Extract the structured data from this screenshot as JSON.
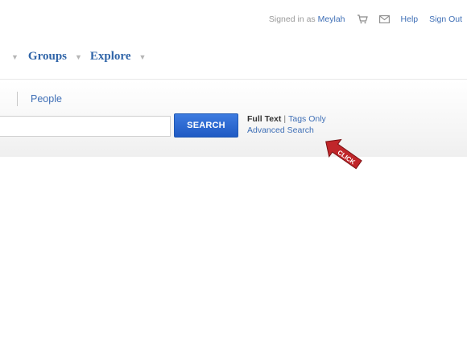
{
  "topbar": {
    "signed_in_as": "Signed in as",
    "username": "Meylah",
    "cart_icon": "cart-icon",
    "mail_icon": "mail-icon",
    "help": "Help",
    "sign_out": "Sign Out"
  },
  "nav": {
    "items": [
      {
        "label": "Groups"
      },
      {
        "label": "Explore"
      }
    ],
    "chevron_icon": "chevron-down-icon"
  },
  "search": {
    "scope_people": "People",
    "input_value": "",
    "button_label": "SEARCH",
    "full_text": "Full Text",
    "separator": "|",
    "tags_only": "Tags Only",
    "advanced": "Advanced Search"
  },
  "annotation": {
    "click_label": "CLICK",
    "color": "#c0262a"
  },
  "colors": {
    "link": "#3f6fb6",
    "nav": "#2f64a8",
    "button": "#1f5ac4"
  }
}
